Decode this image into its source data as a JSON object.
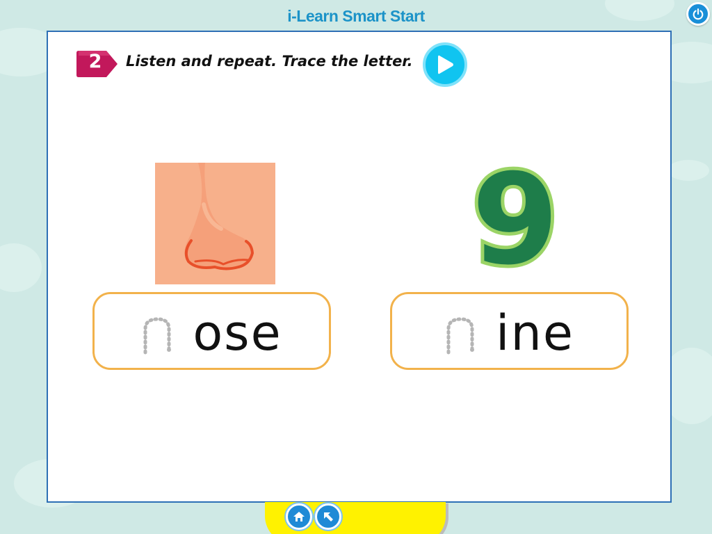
{
  "app": {
    "title": "i-Learn Smart Start"
  },
  "header": {
    "power_icon": "power-icon"
  },
  "exercise": {
    "step_number": "2",
    "instruction": "Listen and repeat. Trace the letter.",
    "play_icon": "play-icon"
  },
  "cards": [
    {
      "image": "nose-picture",
      "trace_letter": "n",
      "word_rest": "ose"
    },
    {
      "image": "number-nine-picture",
      "trace_letter": "n",
      "word_rest": "ine"
    }
  ],
  "nine_glyph": "9",
  "bottom_nav": {
    "home_icon": "home-icon",
    "back_icon": "back-arrow-icon"
  },
  "colors": {
    "title": "#1c93c8",
    "badge": "#c2185b",
    "play_button": "#10c4f0",
    "card_border": "#f2b24b",
    "nine_fill": "#1e7d4a",
    "nine_outline": "#9bd466",
    "bottom_bar": "#fff200"
  }
}
